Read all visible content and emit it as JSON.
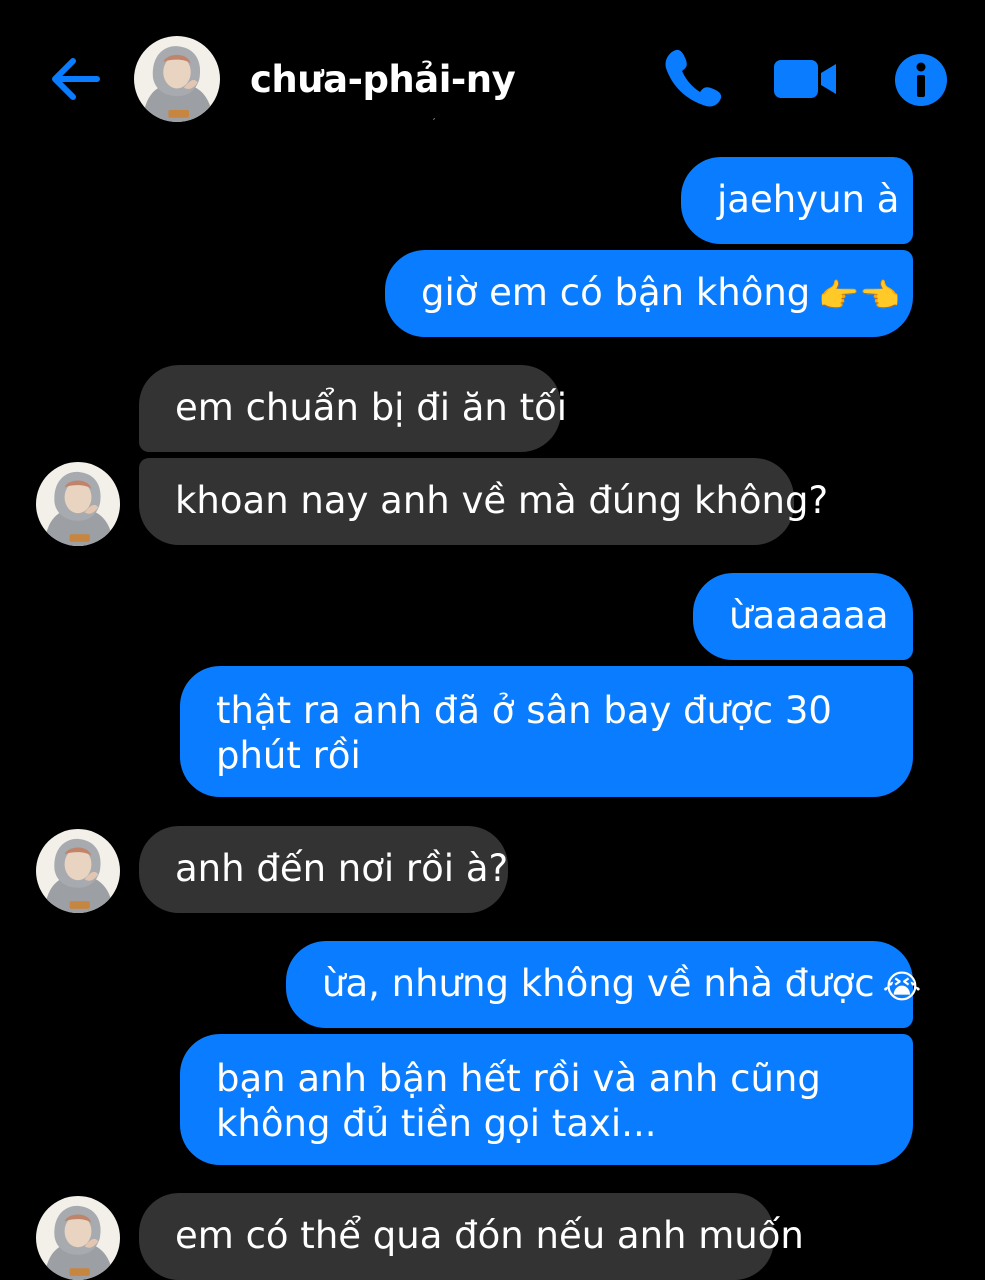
{
  "conversation": {
    "contact_name": "chưa-phải-ny",
    "status_mark": "ˊ"
  },
  "icons": {
    "back": "arrow-left-icon",
    "call": "phone-icon",
    "video": "video-camera-icon",
    "info": "info-icon"
  },
  "colors": {
    "accent": "#0a7cff",
    "outgoing_bubble": "#0a7cff",
    "incoming_bubble": "#333333",
    "background": "#000000"
  },
  "messages": [
    {
      "direction": "out",
      "text": "jaehyun à"
    },
    {
      "direction": "out",
      "text": "giờ em có bận không",
      "emoji": "👉👈"
    },
    {
      "direction": "in",
      "text": "em chuẩn bị đi ăn tối"
    },
    {
      "direction": "in",
      "text": "khoan nay anh về mà đúng không?"
    },
    {
      "direction": "out",
      "text": "ừaaaaaa"
    },
    {
      "direction": "out",
      "text": "thật ra anh đã ở sân bay được 30 phút rồi"
    },
    {
      "direction": "in",
      "text": "anh đến nơi rồi à?"
    },
    {
      "direction": "out",
      "text": "ừa, nhưng không về nhà được",
      "emoji": "😭"
    },
    {
      "direction": "out",
      "text": "bạn anh bận hết rồi và anh cũng không đủ tiền gọi taxi..."
    },
    {
      "direction": "in",
      "text": "em có thể qua đón nếu anh muốn"
    }
  ]
}
